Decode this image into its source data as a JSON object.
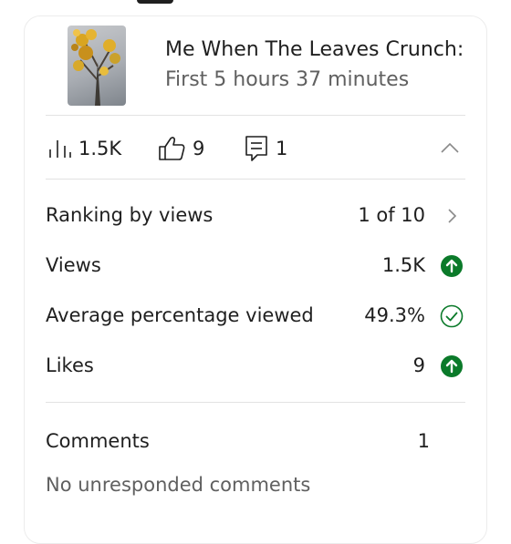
{
  "video": {
    "title_line1": "Me When The Leaves Crunch:",
    "title_line2": "First 5 hours 37 minutes"
  },
  "stats_bar": {
    "views": "1.5K",
    "likes": "9",
    "comments": "1",
    "icons": [
      "views-bars-icon",
      "thumb-up-icon",
      "comment-icon",
      "chevron-up-icon"
    ]
  },
  "metrics": {
    "ranking_label": "Ranking by views",
    "ranking_value": "1 of 10",
    "views_label": "Views",
    "views_value": "1.5K",
    "avg_label": "Average percentage viewed",
    "avg_value": "49.3%",
    "likes_label": "Likes",
    "likes_value": "9"
  },
  "comments_section": {
    "label": "Comments",
    "count": "1",
    "status": "No unresponded comments"
  },
  "colors": {
    "positive_green": "#0b7a2a",
    "text": "#1f1f1f",
    "secondary_text": "#606060",
    "divider": "#e2e2e2"
  }
}
